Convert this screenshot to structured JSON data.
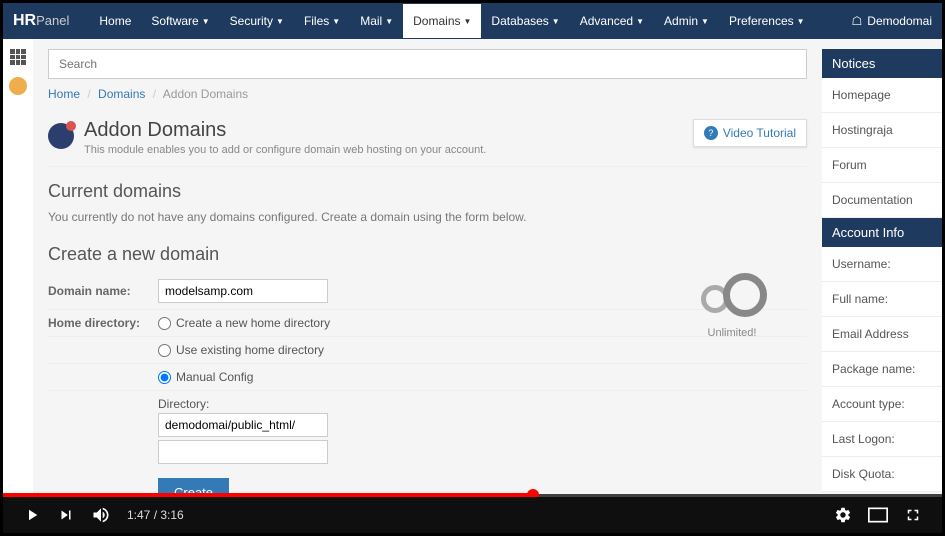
{
  "logo": {
    "a": "HR",
    "b": "Panel"
  },
  "nav": {
    "home": "Home",
    "software": "Software",
    "security": "Security",
    "files": "Files",
    "mail": "Mail",
    "domains": "Domains",
    "databases": "Databases",
    "advanced": "Advanced",
    "admin": "Admin",
    "preferences": "Preferences",
    "user": "Demodomai"
  },
  "search": {
    "placeholder": "Search"
  },
  "breadcrumb": {
    "home": "Home",
    "domains": "Domains",
    "current": "Addon Domains"
  },
  "page": {
    "title": "Addon Domains",
    "subtitle": "This module enables you to add or configure domain web hosting on your account.",
    "video_tutorial": "Video Tutorial"
  },
  "current": {
    "heading": "Current domains",
    "text": "You currently do not have any domains configured. Create a domain using the form below."
  },
  "create": {
    "heading": "Create a new domain",
    "domain_label": "Domain name:",
    "domain_value": "modelsamp.com",
    "home_label": "Home directory:",
    "opt_new": "Create a new home directory",
    "opt_existing": "Use existing home directory",
    "opt_manual": "Manual Config",
    "dir_label": "Directory:",
    "dir_value": "demodomai/public_html/",
    "extra_value": "",
    "button": "Create",
    "unlimited": "Unlimited!"
  },
  "notices": {
    "head": "Notices",
    "items": [
      "Homepage",
      "Hostingraja",
      "Forum",
      "Documentation"
    ]
  },
  "account": {
    "head": "Account Info",
    "labels": [
      "Username:",
      "Full name:",
      "Email Address",
      "Package name:",
      "Account type:",
      "Last Logon:",
      "Disk Quota:"
    ]
  },
  "player": {
    "current": "1:47",
    "total": "3:16"
  }
}
